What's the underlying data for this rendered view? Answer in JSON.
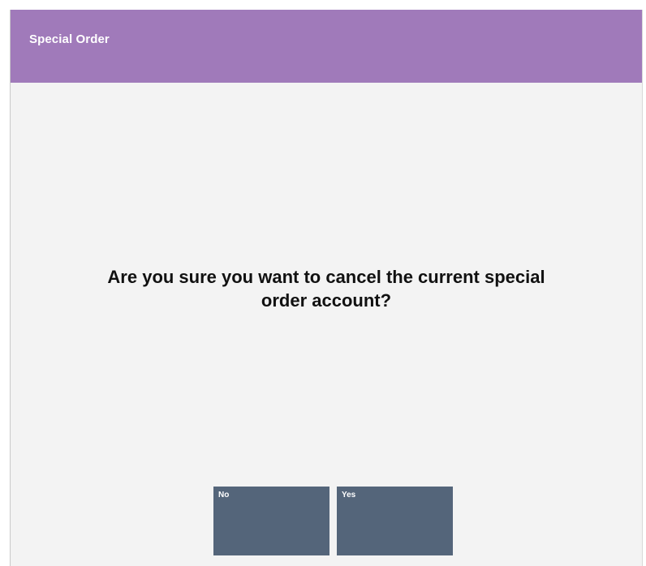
{
  "dialog": {
    "title": "Special Order",
    "message_line1": "Are you sure you want to cancel the current special",
    "message_line2": "order account?",
    "buttons": [
      {
        "label": "No"
      },
      {
        "label": "Yes"
      }
    ]
  },
  "colors": {
    "title_bar": "#a07aba",
    "button": "#54657a",
    "background": "#f3f3f3"
  }
}
